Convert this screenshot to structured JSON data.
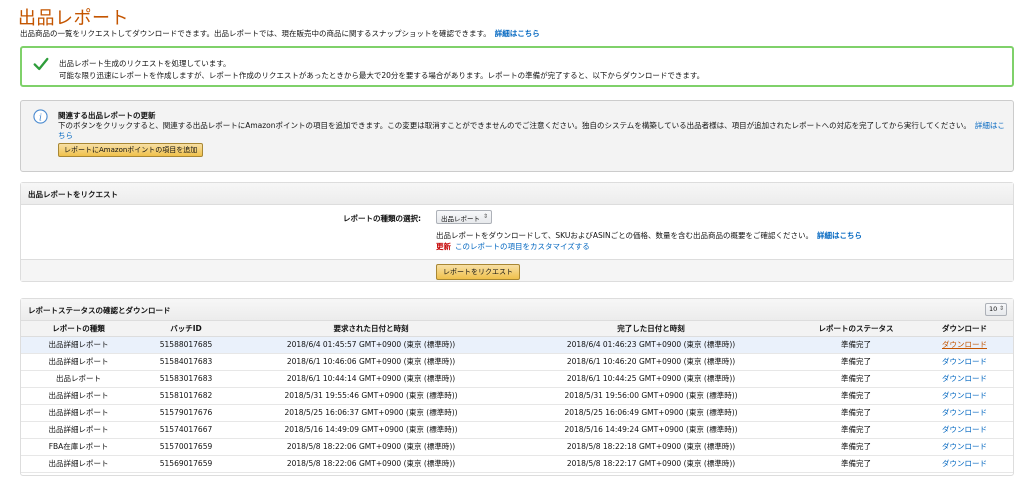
{
  "page": {
    "title": "出品レポート",
    "description": "出品商品の一覧をリクエストしてダウンロードできます。出品レポートでは、現在販売中の商品に関するスナップショットを確認できます。",
    "details_link": "詳細はこちら"
  },
  "success": {
    "line1": "出品レポート生成のリクエストを処理しています。",
    "line2": "可能な限り迅速にレポートを作成しますが、レポート作成のリクエストがあったときから最大で20分を要する場合があります。レポートの準備が完了すると、以下からダウンロードできます。"
  },
  "info": {
    "title": "関連する出品レポートの更新",
    "body": "下のボタンをクリックすると、関連する出品レポートにAmazonポイントの項目を追加できます。この変更は取消すことができませんのでご注意ください。独自のシステムを構築している出品者様は、項目が追加されたレポートへの対応を完了してから実行してください。",
    "link": "詳細はこちら",
    "button": "レポートにAmazonポイントの項目を追加"
  },
  "request": {
    "header": "出品レポートをリクエスト",
    "type_label": "レポートの種類の選択:",
    "selected_type": "出品レポート",
    "description": "出品レポートをダウンロードして、SKUおよびASINごとの価格、数量を含む出品商品の概要をご確認ください。",
    "details_link": "詳細はこちら",
    "new_label": "更新",
    "customize_link": "このレポートの項目をカスタマイズする",
    "button": "レポートをリクエスト"
  },
  "status": {
    "header": "レポートステータスの確認とダウンロード",
    "rows_per_page": "10",
    "columns": [
      "レポートの種類",
      "バッチID",
      "要求された日付と時刻",
      "完了した日付と時刻",
      "レポートのステータス",
      "ダウンロード"
    ],
    "rows": [
      {
        "type": "出品詳細レポート",
        "batch": "51588017685",
        "requested": "2018/6/4 01:45:57 GMT+0900 (東京 (標準時))",
        "completed": "2018/6/4 01:46:23 GMT+0900 (東京 (標準時))",
        "status": "準備完了",
        "download": "ダウンロード"
      },
      {
        "type": "出品詳細レポート",
        "batch": "51584017683",
        "requested": "2018/6/1 10:46:06 GMT+0900 (東京 (標準時))",
        "completed": "2018/6/1 10:46:20 GMT+0900 (東京 (標準時))",
        "status": "準備完了",
        "download": "ダウンロード"
      },
      {
        "type": "出品レポート",
        "batch": "51583017683",
        "requested": "2018/6/1 10:44:14 GMT+0900 (東京 (標準時))",
        "completed": "2018/6/1 10:44:25 GMT+0900 (東京 (標準時))",
        "status": "準備完了",
        "download": "ダウンロード"
      },
      {
        "type": "出品詳細レポート",
        "batch": "51581017682",
        "requested": "2018/5/31 19:55:46 GMT+0900 (東京 (標準時))",
        "completed": "2018/5/31 19:56:00 GMT+0900 (東京 (標準時))",
        "status": "準備完了",
        "download": "ダウンロード"
      },
      {
        "type": "出品詳細レポート",
        "batch": "51579017676",
        "requested": "2018/5/25 16:06:37 GMT+0900 (東京 (標準時))",
        "completed": "2018/5/25 16:06:49 GMT+0900 (東京 (標準時))",
        "status": "準備完了",
        "download": "ダウンロード"
      },
      {
        "type": "出品詳細レポート",
        "batch": "51574017667",
        "requested": "2018/5/16 14:49:09 GMT+0900 (東京 (標準時))",
        "completed": "2018/5/16 14:49:24 GMT+0900 (東京 (標準時))",
        "status": "準備完了",
        "download": "ダウンロード"
      },
      {
        "type": "FBA在庫レポート",
        "batch": "51570017659",
        "requested": "2018/5/8 18:22:06 GMT+0900 (東京 (標準時))",
        "completed": "2018/5/8 18:22:18 GMT+0900 (東京 (標準時))",
        "status": "準備完了",
        "download": "ダウンロード"
      },
      {
        "type": "出品詳細レポート",
        "batch": "51569017659",
        "requested": "2018/5/8 18:22:06 GMT+0900 (東京 (標準時))",
        "completed": "2018/5/8 18:22:17 GMT+0900 (東京 (標準時))",
        "status": "準備完了",
        "download": "ダウンロード"
      }
    ]
  },
  "colors": {
    "title": "#c45500",
    "link": "#0066c0",
    "success_border": "#7fd16a",
    "success_check": "#2e9d3a",
    "info_icon": "#4a8ad0",
    "button_yellow": "#f0c14b"
  },
  "icons": {
    "success": "check-icon",
    "info": "info-icon",
    "select": "updown-arrow-icon"
  }
}
